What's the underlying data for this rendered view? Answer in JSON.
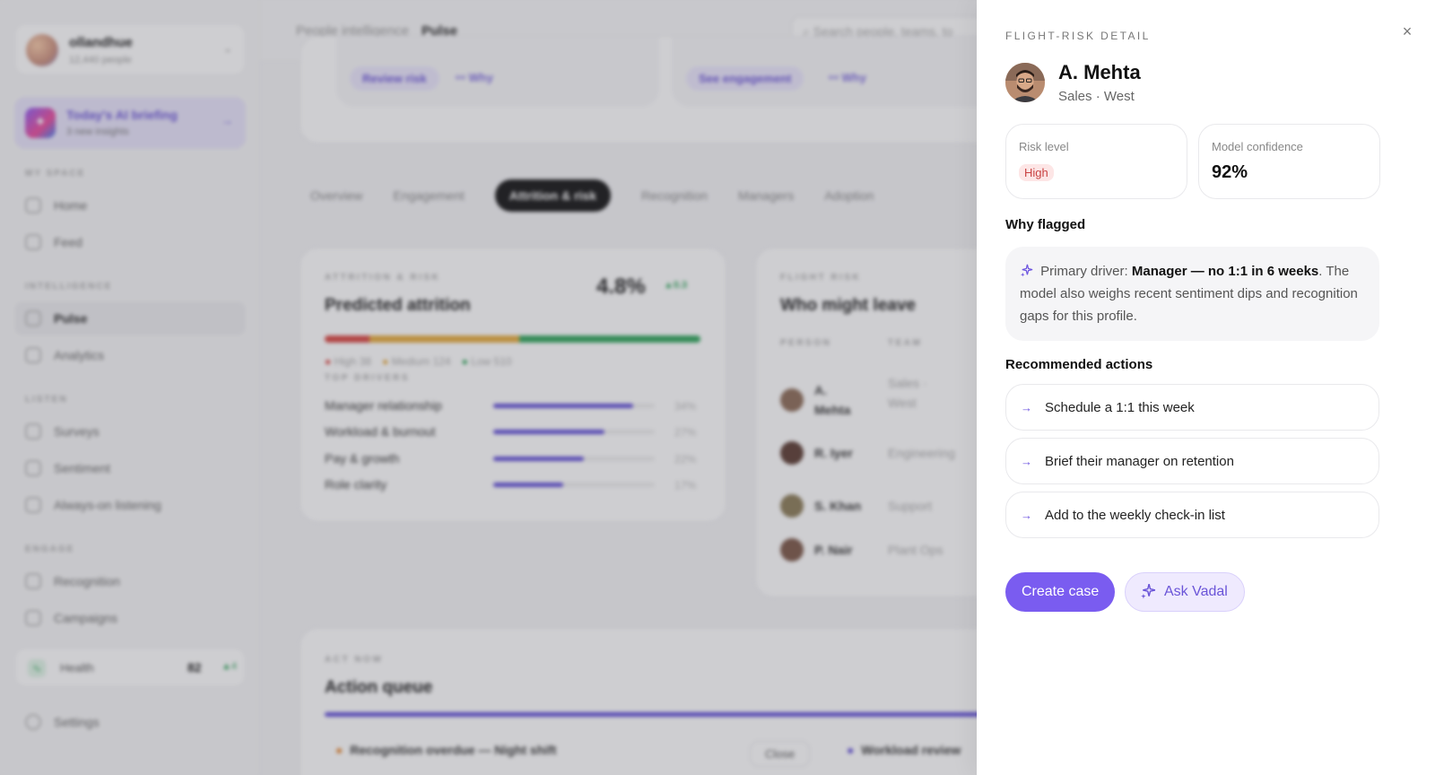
{
  "background": {
    "account": {
      "name": "ollandhue",
      "sub": "12,440 people"
    },
    "briefing": {
      "title": "Today's AI briefing",
      "sub": "3 new insights"
    },
    "sidebar_sections": {
      "my_space": "MY SPACE",
      "intelligence": "INTELLIGENCE",
      "listen": "LISTEN",
      "engage": "ENGAGE"
    },
    "nav": {
      "home": "Home",
      "feed": "Feed",
      "pulse": "Pulse",
      "analytics": "Analytics",
      "surveys": "Surveys",
      "sentiment": "Sentiment",
      "always_on": "Always-on listening",
      "recognition": "Recognition",
      "campaigns": "Campaigns",
      "settings": "Settings"
    },
    "health": {
      "label": "Health",
      "value": "82",
      "delta": "▲4"
    },
    "breadcrumb": {
      "parent": "People intelligence",
      "current": "Pulse"
    },
    "search_placeholder": "Search people, teams, to",
    "buttons": {
      "review_risk": "Review risk",
      "see_engagement": "See engagement",
      "why": "Why"
    },
    "tabs": [
      "Overview",
      "Engagement",
      "Attrition & risk",
      "Recognition",
      "Managers",
      "Adoption"
    ],
    "attrition": {
      "eyebrow": "ATTRITION & RISK",
      "title": "Predicted attrition",
      "value": "4.8%",
      "delta": "▲0.3",
      "legend": [
        "High 38",
        "Medium 124",
        "Low 510"
      ],
      "drivers_label": "TOP DRIVERS",
      "drivers": [
        {
          "name": "Manager relationship",
          "pct": "34%"
        },
        {
          "name": "Workload & burnout",
          "pct": "27%"
        },
        {
          "name": "Pay & growth",
          "pct": "22%"
        },
        {
          "name": "Role clarity",
          "pct": "17%"
        }
      ]
    },
    "flight": {
      "eyebrow": "FLIGHT RISK",
      "title": "Who might leave",
      "cols": [
        "PERSON",
        "TEAM"
      ],
      "rows": [
        {
          "name": "A. Mehta",
          "team": "Sales · West"
        },
        {
          "name": "R. Iyer",
          "team": "Engineering"
        },
        {
          "name": "S. Khan",
          "team": "Support"
        },
        {
          "name": "P. Nair",
          "team": "Plant Ops"
        }
      ]
    },
    "act_now": {
      "eyebrow": "ACT NOW",
      "title": "Action queue",
      "item1": "Recognition overdue — Night shift",
      "close": "Close",
      "item2": "Workload review"
    }
  },
  "panel": {
    "eyebrow": "FLIGHT-RISK DETAIL",
    "close_icon": "×",
    "name": "A. Mehta",
    "team": "Sales · West",
    "risk_label": "Risk level",
    "risk_value": "High",
    "confidence_label": "Model confidence",
    "confidence_value": "92%",
    "why_heading": "Why flagged",
    "why_prefix": "Primary driver: ",
    "why_driver": "Manager — no 1:1 in 6 weeks",
    "why_suffix": ". The model also weighs recent sentiment dips and recognition gaps for this profile.",
    "actions_heading": "Recommended actions",
    "actions": [
      "Schedule a 1:1 this week",
      "Brief their manager on retention",
      "Add to the weekly check-in list"
    ],
    "create_case": "Create case",
    "ask_vadal": "Ask Vadal"
  },
  "colors": {
    "accent": "#7a5cf0",
    "risk_high_bg": "#fde6e6",
    "risk_high_fg": "#c94242"
  }
}
